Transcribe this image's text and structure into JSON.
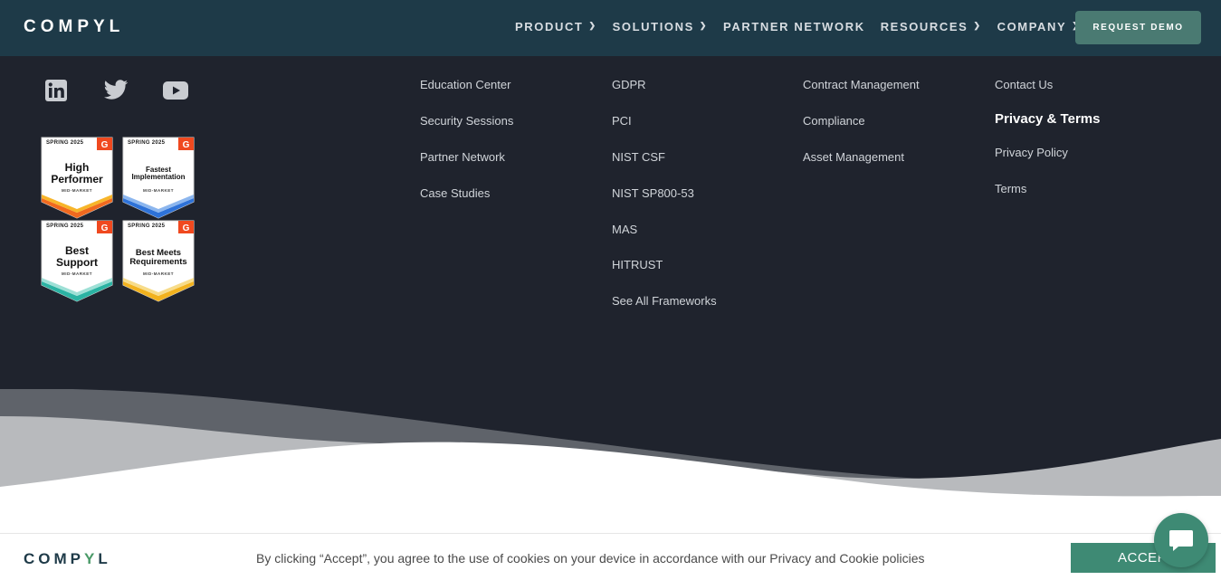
{
  "header": {
    "logo": "COMPYL",
    "nav": [
      {
        "label": "PRODUCT",
        "has_dropdown": true
      },
      {
        "label": "SOLUTIONS",
        "has_dropdown": true
      },
      {
        "label": "PARTNER NETWORK",
        "has_dropdown": false
      },
      {
        "label": "RESOURCES",
        "has_dropdown": true
      },
      {
        "label": "COMPANY",
        "has_dropdown": true
      }
    ],
    "cta": "REQUEST DEMO"
  },
  "social": [
    "linkedin-icon",
    "twitter-icon",
    "youtube-icon"
  ],
  "badges": [
    {
      "season": "SPRING 2025",
      "title_lines": [
        "High",
        "Performer"
      ],
      "segment": "MID-MARKET",
      "accent": "#f0691f"
    },
    {
      "season": "SPRING 2025",
      "title_lines": [
        "Fastest",
        "Implementation"
      ],
      "segment": "MID-MARKET",
      "accent": "#2e72d8"
    },
    {
      "season": "SPRING 2025",
      "title_lines": [
        "Best",
        "Support"
      ],
      "segment": "MID-MARKET",
      "accent": "#2bb3a3"
    },
    {
      "season": "SPRING 2025",
      "title_lines": [
        "Best Meets",
        "Requirements"
      ],
      "segment": "MID-MARKET",
      "accent": "#f2b21e"
    }
  ],
  "footer": {
    "col1": [
      "Education Center",
      "Security Sessions",
      "Partner Network",
      "Case Studies"
    ],
    "col2": [
      "GDPR",
      "PCI",
      "NIST CSF",
      "NIST SP800-53",
      "MAS",
      "HITRUST",
      "See All Frameworks"
    ],
    "col3": [
      "Contract Management",
      "Compliance",
      "Asset Management"
    ],
    "col4": {
      "contact": "Contact Us",
      "heading": "Privacy & Terms",
      "links": [
        "Privacy Policy",
        "Terms"
      ]
    }
  },
  "cookie": {
    "logo_parts": [
      "COMP",
      "Y",
      "L"
    ],
    "text": "By clicking “Accept”, you agree to the use of cookies on your device in accordance with our Privacy and Cookie policies",
    "accept": "ACCEPT"
  },
  "colors": {
    "header_bg": "#1e3a48",
    "body_bg": "#1f232d",
    "demo_btn": "#4a7a72",
    "accept_btn": "#3e8a74"
  }
}
